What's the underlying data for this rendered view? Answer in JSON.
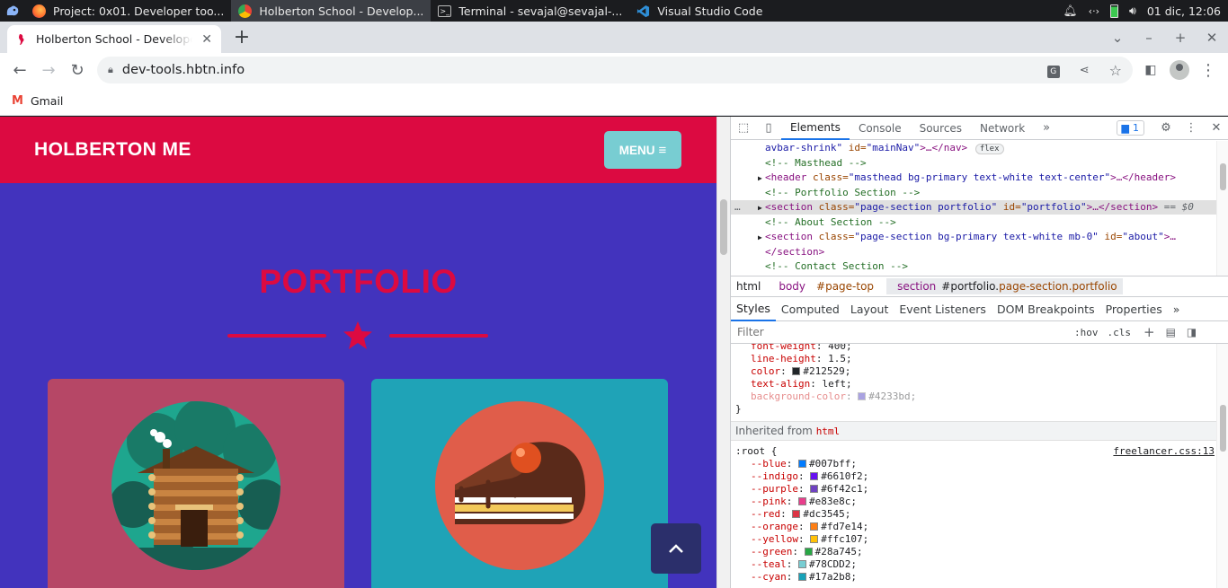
{
  "taskbar": {
    "tasks": [
      {
        "label": "Project: 0x01. Developer too...",
        "active": false
      },
      {
        "label": "Holberton School - Develop...",
        "active": true
      },
      {
        "label": "Terminal - sevajal@sevajal-...",
        "active": false
      },
      {
        "label": "Visual Studio Code",
        "active": false
      }
    ],
    "clock": "01 dic, 12:06"
  },
  "browser": {
    "tab_title": "Holberton School - Developer tools",
    "new_tab": "+",
    "url": "dev-tools.hbtn.info",
    "bookmark": "Gmail"
  },
  "site": {
    "brand": "HOLBERTON ME",
    "menu_label": "MENU",
    "section_title": "PORTFOLIO",
    "colors": {
      "primary": "#dc0a41",
      "background": "#4233bd",
      "teal": "#78cdd2"
    }
  },
  "devtools": {
    "tabs": [
      "Elements",
      "Console",
      "Sources",
      "Network"
    ],
    "issues_count": "1",
    "flex_badge": "flex",
    "dom": {
      "r0": {
        "a": "avbar-shrink\"",
        "b": " id=",
        "c": "\"mainNav\"",
        "d": ">…</nav>"
      },
      "r1": "<!-- Masthead -->",
      "r2": {
        "a": "<header ",
        "b": "class=",
        "c": "\"masthead bg-primary text-white text-center\"",
        "d": ">…</header>"
      },
      "r3": "<!-- Portfolio Section -->",
      "r4": {
        "a": "<section ",
        "b": "class=",
        "c": "\"page-section portfolio\"",
        "e": " id=",
        "f": "\"portfolio\"",
        "d": ">…</section>",
        "g": " == $0"
      },
      "r5": "<!-- About Section -->",
      "r6": {
        "a": "<section ",
        "b": "class=",
        "c": "\"page-section bg-primary text-white mb-0\"",
        "e": " id=",
        "f": "\"about\"",
        "d": ">…"
      },
      "r7": "</section>",
      "r8": "<!-- Contact Section -->"
    },
    "breadcrumb": {
      "html": "html",
      "body_tag": "body",
      "body_id": "#page-top",
      "sec_tag": "section",
      "sec_rest": "#portfolio.",
      "sec_cls": "page-section.portfolio"
    },
    "style_tabs": [
      "Styles",
      "Computed",
      "Layout",
      "Event Listeners",
      "DOM Breakpoints",
      "Properties"
    ],
    "filter_placeholder": "Filter",
    "hov": ":hov",
    "cls": ".cls",
    "body_rules": [
      {
        "prop": "font-weight",
        "value": "400;"
      },
      {
        "prop": "line-height",
        "value": "1.5;"
      },
      {
        "prop": "color",
        "value": "#212529;",
        "swatch": "#212529"
      },
      {
        "prop": "text-align",
        "value": "left;"
      },
      {
        "prop": "background-color",
        "value": "#4233bd;",
        "swatch": "#4233bd"
      }
    ],
    "close_brace": "}",
    "inherited_label": "Inherited from",
    "inherited_from": "html",
    "root_selector": ":root {",
    "root_source": "freelancer.css:13",
    "root_vars": [
      {
        "prop": "--blue",
        "value": "#007bff;",
        "swatch": "#007bff"
      },
      {
        "prop": "--indigo",
        "value": "#6610f2;",
        "swatch": "#6610f2"
      },
      {
        "prop": "--purple",
        "value": "#6f42c1;",
        "swatch": "#6f42c1"
      },
      {
        "prop": "--pink",
        "value": "#e83e8c;",
        "swatch": "#e83e8c"
      },
      {
        "prop": "--red",
        "value": "#dc3545;",
        "swatch": "#dc3545"
      },
      {
        "prop": "--orange",
        "value": "#fd7e14;",
        "swatch": "#fd7e14"
      },
      {
        "prop": "--yellow",
        "value": "#ffc107;",
        "swatch": "#ffc107"
      },
      {
        "prop": "--green",
        "value": "#28a745;",
        "swatch": "#28a745"
      },
      {
        "prop": "--teal",
        "value": "#78CDD2;",
        "swatch": "#78CDD2"
      },
      {
        "prop": "--cyan",
        "value": "#17a2b8;",
        "swatch": "#17a2b8"
      }
    ]
  }
}
